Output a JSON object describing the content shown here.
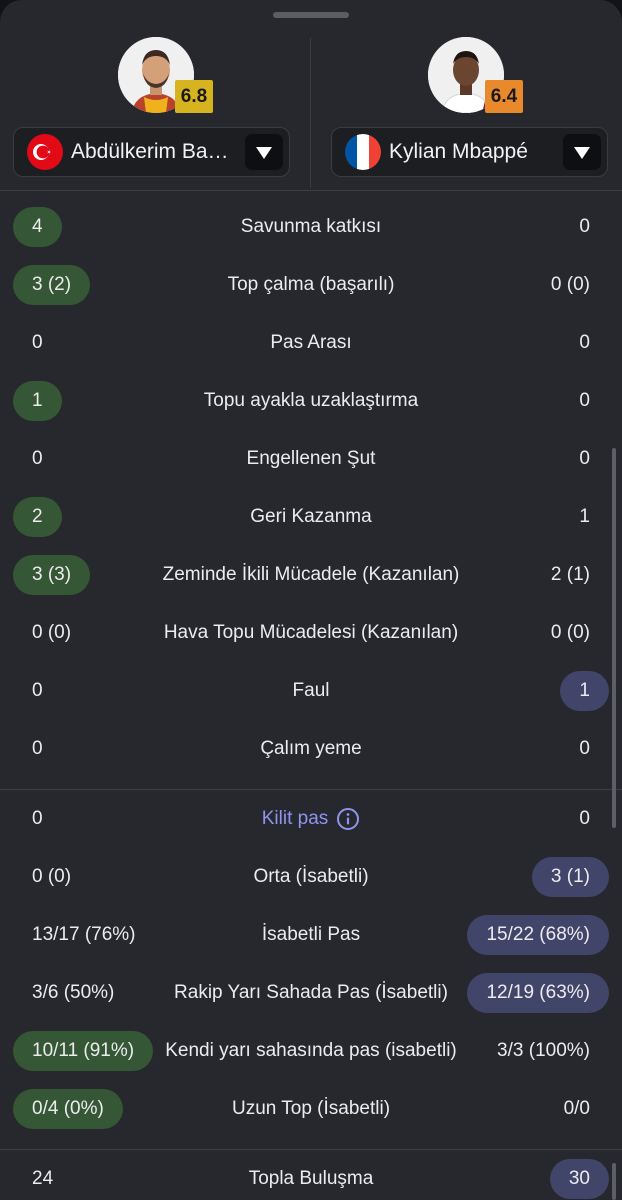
{
  "players": {
    "left": {
      "name": "Abdülkerim Ba…",
      "rating": "6.8",
      "flag": "turkey-flag",
      "rating_color": "#d8b320"
    },
    "right": {
      "name": "Kylian Mbappé",
      "rating": "6.4",
      "flag": "france-flag",
      "rating_color": "#e88a2c"
    }
  },
  "colors": {
    "left_highlight": "#355736",
    "right_highlight": "#414569",
    "link": "#8f93f0"
  },
  "defense_stats": [
    {
      "label": "Savunma katkısı",
      "left": "4",
      "right": "0",
      "hl": "left"
    },
    {
      "label": "Top çalma (başarılı)",
      "left": "3 (2)",
      "right": "0 (0)",
      "hl": "left"
    },
    {
      "label": "Pas Arası",
      "left": "0",
      "right": "0",
      "hl": ""
    },
    {
      "label": "Topu ayakla uzaklaştırma",
      "left": "1",
      "right": "0",
      "hl": "left"
    },
    {
      "label": "Engellenen Şut",
      "left": "0",
      "right": "0",
      "hl": ""
    },
    {
      "label": "Geri Kazanma",
      "left": "2",
      "right": "1",
      "hl": "left"
    },
    {
      "label": "Zeminde İkili Mücadele (Kazanılan)",
      "left": "3 (3)",
      "right": "2 (1)",
      "hl": "left"
    },
    {
      "label": "Hava Topu Mücadelesi (Kazanılan)",
      "left": "0 (0)",
      "right": "0 (0)",
      "hl": ""
    },
    {
      "label": "Faul",
      "left": "0",
      "right": "1",
      "hl": "right"
    },
    {
      "label": "Çalım yeme",
      "left": "0",
      "right": "0",
      "hl": ""
    }
  ],
  "passing_stats": [
    {
      "label": "Kilit pas",
      "left": "0",
      "right": "0",
      "hl": "",
      "link": true,
      "icon": "info-icon"
    },
    {
      "label": "Orta (İsabetli)",
      "left": "0 (0)",
      "right": "3 (1)",
      "hl": "right"
    },
    {
      "label": "İsabetli Pas",
      "left": "13/17 (76%)",
      "right": "15/22 (68%)",
      "hl": "right"
    },
    {
      "label": "Rakip Yarı Sahada Pas (İsabetli)",
      "left": "3/6 (50%)",
      "right": "12/19 (63%)",
      "hl": "right"
    },
    {
      "label": "Kendi yarı sahasında pas (isabetli)",
      "left": "10/11 (91%)",
      "right": "3/3 (100%)",
      "hl": "left"
    },
    {
      "label": "Uzun Top (İsabetli)",
      "left": "0/4 (0%)",
      "right": "0/0",
      "hl": "left"
    }
  ],
  "general_stats": [
    {
      "label": "Topla Buluşma",
      "left": "24",
      "right": "30",
      "hl": "right"
    }
  ]
}
